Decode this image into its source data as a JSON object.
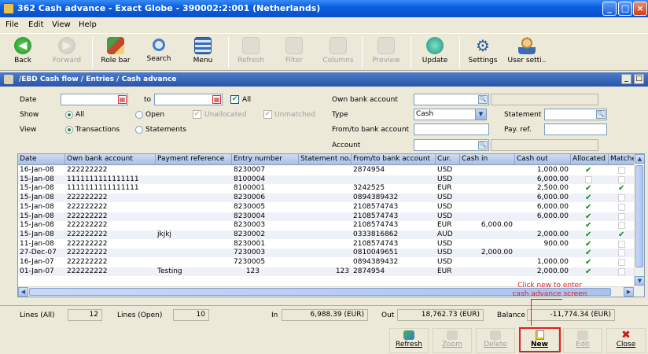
{
  "window": {
    "title": "362 Cash advance - Exact Globe - 390002:2:001 (Netherlands)",
    "minimize": "_",
    "maximize": "□",
    "close": "×"
  },
  "menu": [
    "File",
    "Edit",
    "View",
    "Help"
  ],
  "toolbar": [
    {
      "label": "Back",
      "icon": "back-icon",
      "enabled": true,
      "color": "#2e9a2e"
    },
    {
      "label": "Forward",
      "icon": "forward-icon",
      "enabled": false,
      "color": "#888888"
    },
    {
      "label": "Role bar",
      "icon": "role-bar-icon",
      "enabled": true,
      "color": "#c04a2a"
    },
    {
      "label": "Search",
      "icon": "search-icon",
      "enabled": true,
      "color": "#4a7cc4"
    },
    {
      "label": "Menu",
      "icon": "menu-icon",
      "enabled": true,
      "color": "#3a6cb8"
    },
    {
      "label": "Refresh",
      "icon": "refresh-icon",
      "enabled": false,
      "color": "#888888"
    },
    {
      "label": "Filter",
      "icon": "filter-icon",
      "enabled": false,
      "color": "#888888"
    },
    {
      "label": "Columns",
      "icon": "columns-icon",
      "enabled": false,
      "color": "#888888"
    },
    {
      "label": "Preview",
      "icon": "preview-icon",
      "enabled": false,
      "color": "#888888"
    },
    {
      "label": "Update",
      "icon": "update-icon",
      "enabled": true,
      "color": "#1d8f7a"
    },
    {
      "label": "Settings",
      "icon": "settings-icon",
      "enabled": true,
      "color": "#2f5a9c"
    },
    {
      "label": "User setti..",
      "icon": "user-settings-icon",
      "enabled": true,
      "color": "#b8862a"
    }
  ],
  "breadcrumb": {
    "text": "/EBD  Cash flow / Entries / Cash advance",
    "buttons": [
      "_",
      "□"
    ]
  },
  "form": {
    "date_label": "Date",
    "date_from": "",
    "to_label": "to",
    "date_to": "",
    "all_label": "All",
    "show_label": "Show",
    "show_options": [
      "All",
      "Open",
      "Unallocated",
      "Unmatched"
    ],
    "view_label": "View",
    "view_options": [
      "Transactions",
      "Statements"
    ],
    "own_bank_label": "Own bank account",
    "own_bank_value": "",
    "type_label": "Type",
    "type_value": "Cash",
    "from_to_label": "From/to bank account",
    "from_to_value": "",
    "account_label": "Account",
    "account_value": "",
    "statement_label": "Statement",
    "statement_value": "",
    "payref_label": "Pay. ref.",
    "payref_value": ""
  },
  "grid": {
    "columns": [
      "Date",
      "Own bank account",
      "Payment reference",
      "Entry number",
      "Statement no.",
      "From/to bank account",
      "Cur.",
      "Cash in",
      "Cash out",
      "Allocated",
      "Matched"
    ],
    "rows": [
      {
        "date": "16-Jan-08",
        "own": "222222222",
        "ref": "",
        "entry": "8230007",
        "stmt": "",
        "fromto": "2874954",
        "cur": "USD",
        "cashin": "",
        "cashout": "1,000.00",
        "allocated": true,
        "matched": false
      },
      {
        "date": "15-Jan-08",
        "own": "1111111111111111",
        "ref": "",
        "entry": "8100004",
        "stmt": "",
        "fromto": "",
        "cur": "USD",
        "cashin": "",
        "cashout": "6,000.00",
        "allocated": false,
        "matched": false
      },
      {
        "date": "15-Jan-08",
        "own": "1111111111111111",
        "ref": "",
        "entry": "8100001",
        "stmt": "",
        "fromto": "3242525",
        "cur": "EUR",
        "cashin": "",
        "cashout": "2,500.00",
        "allocated": true,
        "matched": true
      },
      {
        "date": "15-Jan-08",
        "own": "222222222",
        "ref": "",
        "entry": "8230006",
        "stmt": "",
        "fromto": "0894389432",
        "cur": "USD",
        "cashin": "",
        "cashout": "6,000.00",
        "allocated": true,
        "matched": false
      },
      {
        "date": "15-Jan-08",
        "own": "222222222",
        "ref": "",
        "entry": "8230005",
        "stmt": "",
        "fromto": "2108574743",
        "cur": "USD",
        "cashin": "",
        "cashout": "6,000.00",
        "allocated": true,
        "matched": false
      },
      {
        "date": "15-Jan-08",
        "own": "222222222",
        "ref": "",
        "entry": "8230004",
        "stmt": "",
        "fromto": "2108574743",
        "cur": "USD",
        "cashin": "",
        "cashout": "6,000.00",
        "allocated": true,
        "matched": false
      },
      {
        "date": "15-Jan-08",
        "own": "222222222",
        "ref": "",
        "entry": "8230003",
        "stmt": "",
        "fromto": "2108574743",
        "cur": "EUR",
        "cashin": "6,000.00",
        "cashout": "",
        "allocated": true,
        "matched": false
      },
      {
        "date": "15-Jan-08",
        "own": "222222222",
        "ref": "jkjkj",
        "entry": "8230002",
        "stmt": "",
        "fromto": "0333816862",
        "cur": "AUD",
        "cashin": "",
        "cashout": "2,000.00",
        "allocated": true,
        "matched": true
      },
      {
        "date": "11-Jan-08",
        "own": "222222222",
        "ref": "",
        "entry": "8230001",
        "stmt": "",
        "fromto": "2108574743",
        "cur": "USD",
        "cashin": "",
        "cashout": "900.00",
        "allocated": true,
        "matched": false
      },
      {
        "date": "27-Dec-07",
        "own": "222222222",
        "ref": "",
        "entry": "7230003",
        "stmt": "",
        "fromto": "0810049651",
        "cur": "USD",
        "cashin": "2,000.00",
        "cashout": "",
        "allocated": true,
        "matched": false
      },
      {
        "date": "16-Jan-07",
        "own": "222222222",
        "ref": "",
        "entry": "7230005",
        "stmt": "",
        "fromto": "0894389432",
        "cur": "USD",
        "cashin": "",
        "cashout": "1,000.00",
        "allocated": true,
        "matched": false
      },
      {
        "date": "01-Jan-07",
        "own": "222222222",
        "ref": "Testing",
        "entry": "123",
        "stmt": "123",
        "fromto": "2874954",
        "cur": "EUR",
        "cashin": "",
        "cashout": "2,000.00",
        "allocated": true,
        "matched": false
      }
    ]
  },
  "summary": {
    "lines_all_label": "Lines (All)",
    "lines_all": "12",
    "lines_open_label": "Lines (Open)",
    "lines_open": "10",
    "in_label": "In",
    "in_value": "6,988.39 (EUR)",
    "out_label": "Out",
    "out_value": "18,762.73 (EUR)",
    "balance_label": "Balance",
    "balance_value": "-11,774.34 (EUR)"
  },
  "bottom_buttons": [
    {
      "label": "Refresh",
      "icon": "refresh-icon",
      "enabled": true
    },
    {
      "label": "Zoom",
      "icon": "zoom-icon",
      "enabled": false
    },
    {
      "label": "Delete",
      "icon": "delete-icon",
      "enabled": false
    },
    {
      "label": "New",
      "icon": "new-icon",
      "enabled": true
    },
    {
      "label": "Edit",
      "icon": "edit-icon",
      "enabled": false
    },
    {
      "label": "Close",
      "icon": "close-icon",
      "enabled": true
    }
  ],
  "annotation": {
    "line1": "Click new to enter",
    "line2": "cash advance screen"
  }
}
